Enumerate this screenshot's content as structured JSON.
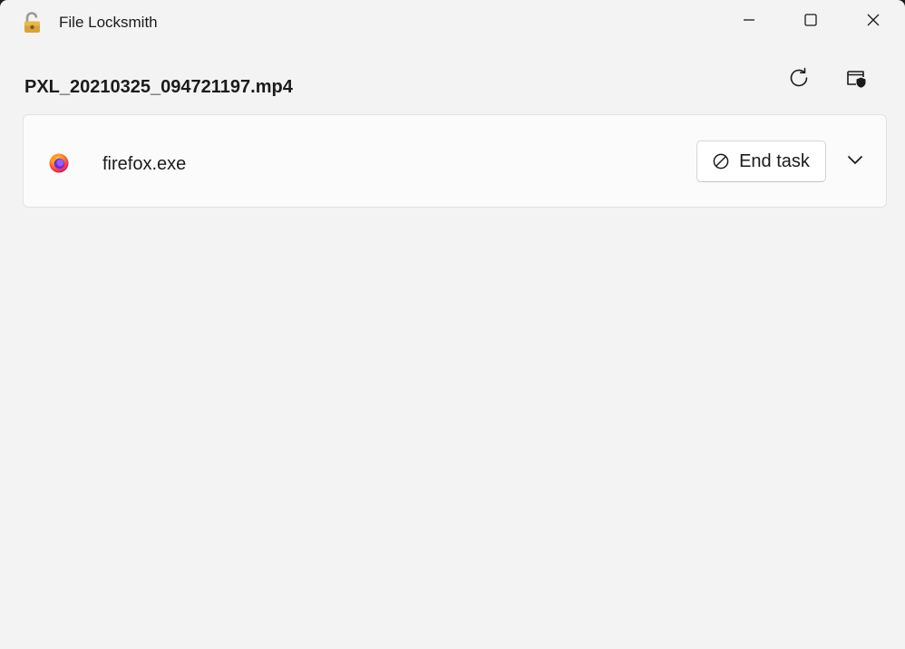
{
  "window": {
    "title": "File Locksmith",
    "icon": "unlocked-padlock-icon",
    "controls": [
      "minimize",
      "maximize",
      "close"
    ]
  },
  "header": {
    "file_name": "PXL_20210325_094721197.mp4",
    "actions": {
      "refresh_icon": "refresh-icon",
      "admin_icon": "restart-as-admin-shield-icon"
    }
  },
  "processes": [
    {
      "name": "firefox.exe",
      "icon": "firefox-icon",
      "end_task_label": "End task",
      "end_task_icon": "block-icon",
      "expand_icon": "chevron-down-icon"
    }
  ],
  "colors": {
    "window_bg": "#f3f3f3",
    "card_bg": "#fbfbfb",
    "text": "#1b1b1b",
    "border": "#e2e2e2"
  }
}
